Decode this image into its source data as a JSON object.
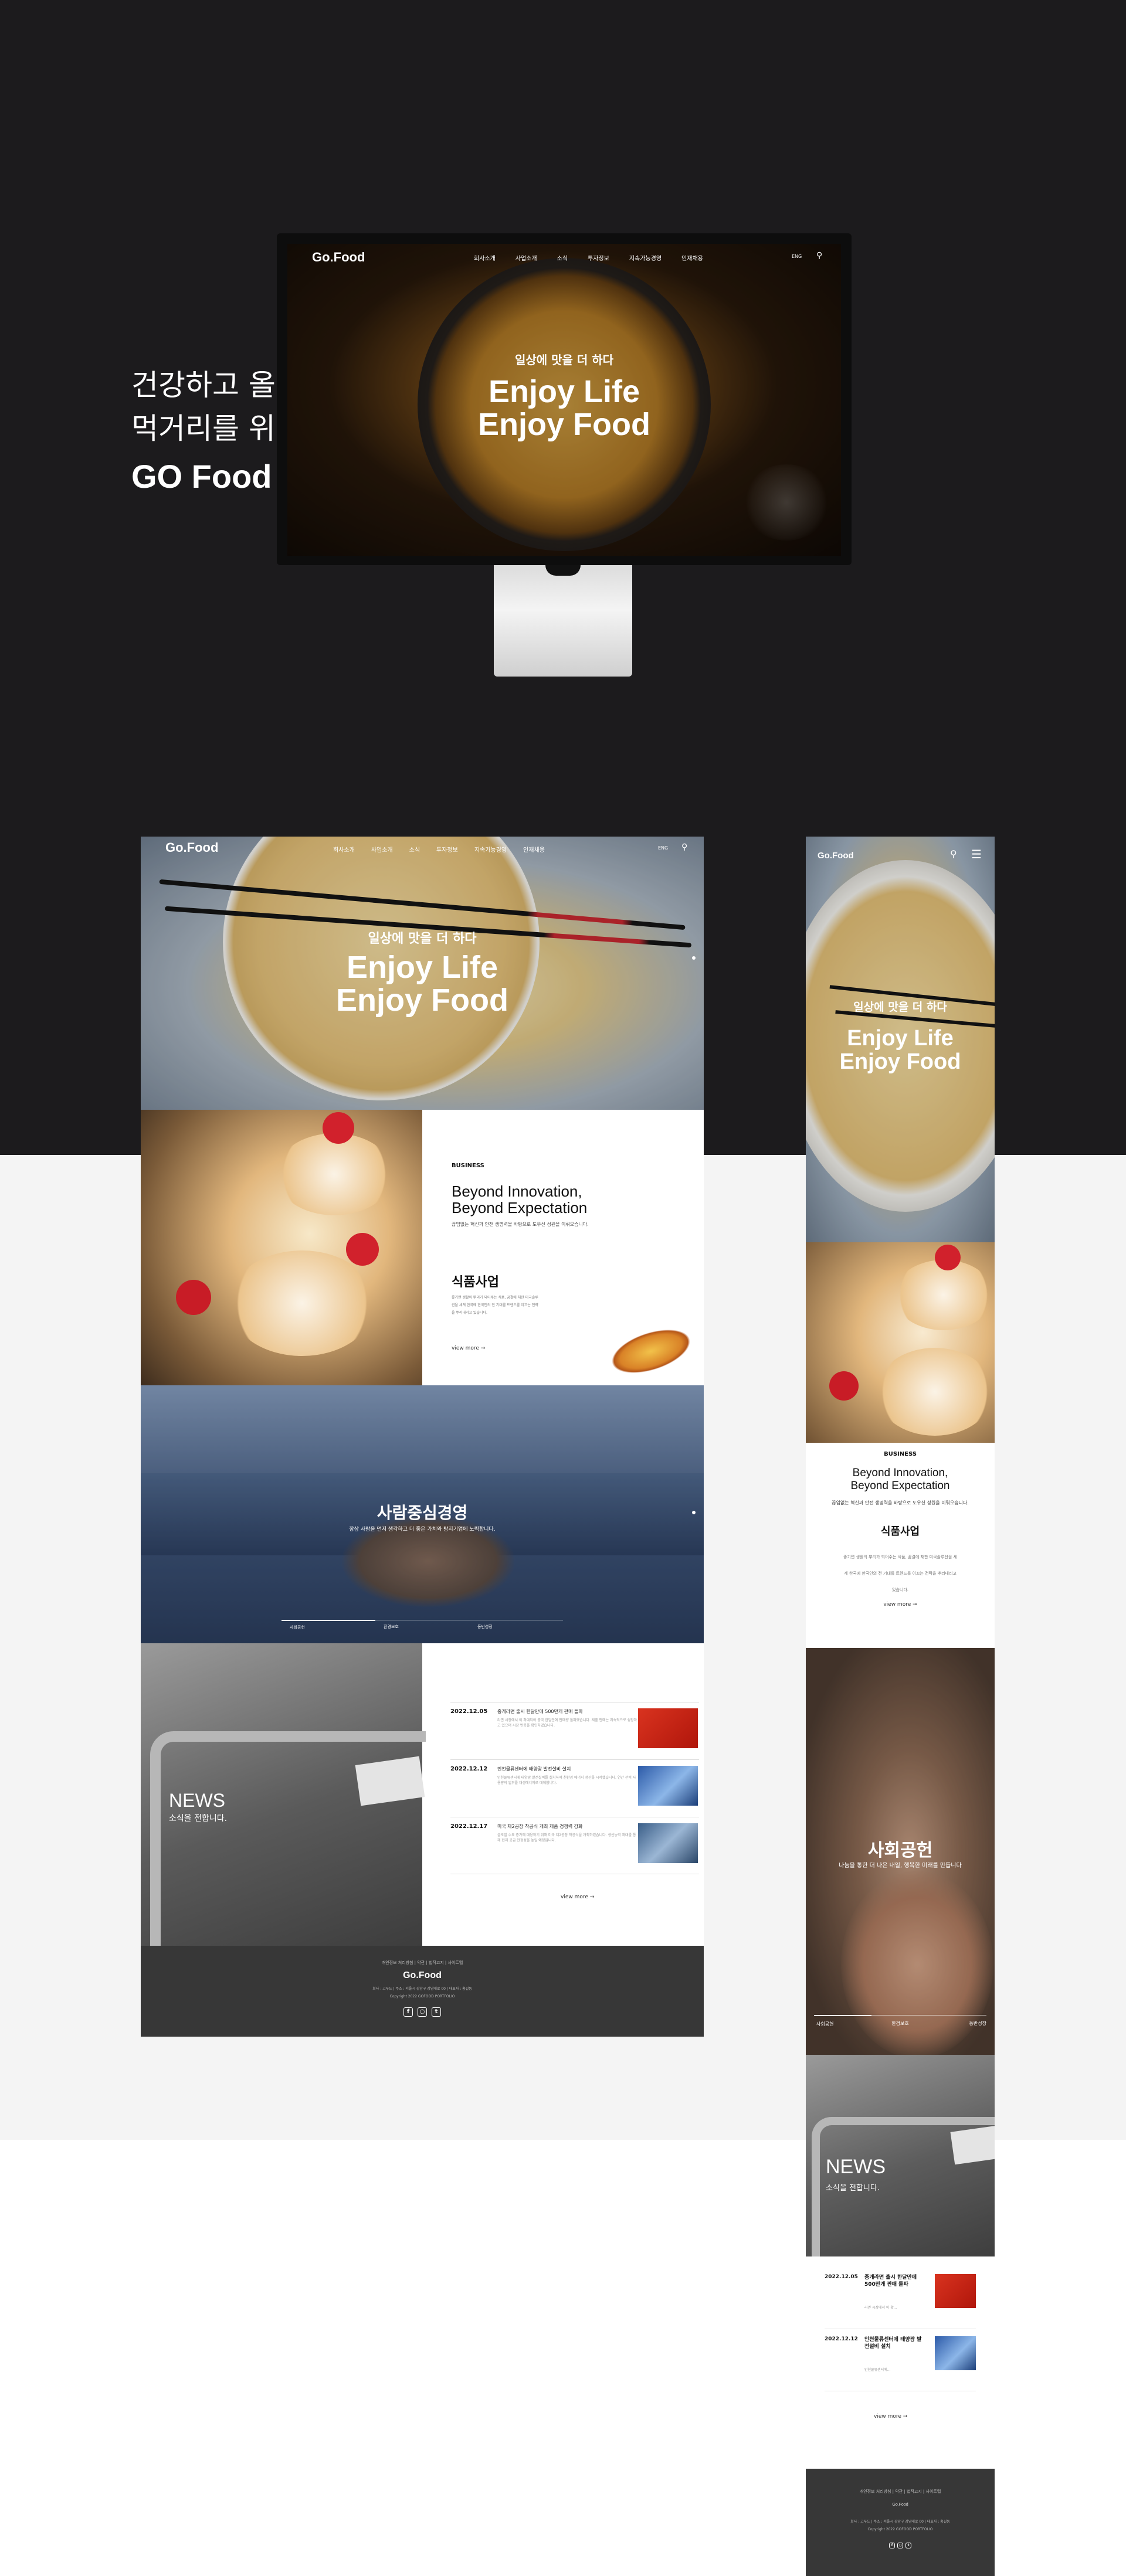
{
  "intro": {
    "line1": "건강하고 올바른",
    "line2": "먹거리를 위해",
    "line3": "GO Food"
  },
  "brand": {
    "logo": "Go.Food"
  },
  "nav": {
    "items": [
      "회사소개",
      "사업소개",
      "소식",
      "투자정보",
      "지속가능경영",
      "인재채용"
    ],
    "lang": "ENG",
    "search_icon": "search-icon",
    "menu_icon": "hamburger-icon"
  },
  "hero": {
    "subtitle": "일상에 맛을 더 하다",
    "title_line1": "Enjoy Life",
    "title_line2": "Enjoy Food"
  },
  "business": {
    "label": "BUSINESS",
    "heading_line1": "Beyond Innovation,",
    "heading_line2": "Beyond Expectation",
    "description": "끊임없는 혁신과 안전 생명력을 바탕으로 도우신 성원을 이뤄오습니다.",
    "section_title": "식품사업",
    "section_text": "좋기면 생활의 뿌리가 되어주는 식품, 꿈결에 채판 미국솔루션을 세계 한국에 한국인의 전 기대를 트렌드를 이끄는 전략을 뿌리내리고 있습니다.",
    "view_more": "view more"
  },
  "people": {
    "title": "사람중심경영",
    "subtitle": "항상 사람을 먼저 생각하고 더 좋은 가치와 탕지기업에 노력합니다.",
    "tabs": [
      "사회공헌",
      "환경보호",
      "동반성장"
    ]
  },
  "social": {
    "title": "사회공헌",
    "subtitle": "나눔을 통한 더 나은 내일, 행복한 미래를 만듭니다"
  },
  "news": {
    "title": "NEWS",
    "subtitle": "소식을 전합니다.",
    "view_more": "view more",
    "items": [
      {
        "date": "2022.12.05",
        "title": "중개라면 출시 한달만에 500만개 판매 돌파",
        "body": "라면 시장에서 이 확대되어 중국 한달만에 판매량 돌파했습니다. 제품 판매는 지속적으로 성장하고 있으며 시장 반응을 확인하였습니다."
      },
      {
        "date": "2022.12.12",
        "title": "인천물류센터에 태양광 발전설비 설치",
        "body": "인천물류센터에 태양광 발전설비를 설치하여 친환경 에너지 생산을 시작했습니다. 연간 전력 사용량의 일부를 재생에너지로 대체합니다."
      },
      {
        "date": "2022.12.17",
        "title": "미국 제2공장 착공식 개최 제품 경쟁력 강화",
        "body": "글로벌 수요 증가에 대응하기 위해 미국 제2공장 착공식을 개최하였습니다. 생산능력 확대를 통해 현지 공급 안정성을 높일 예정입니다."
      }
    ],
    "mobile_items": [
      {
        "date": "2022.12.05",
        "title": "중개라면 출시 한달만에 500만개 판매 돌파",
        "body": "라면 시장에서 이 확..."
      },
      {
        "date": "2022.12.12",
        "title": "인천물류센터에 태양광 발전설비 설치",
        "body": "인천물류센터에..."
      }
    ]
  },
  "footer": {
    "links": "개인정보 처리방침 | 약관 | 법적고지 | 사이트맵",
    "logo": "Go.Food",
    "address": "회사 : 고푸드 | 주소 : 서울시 강남구 강남대로 00 | 대표자 : 홍길동",
    "copyright": "Copyright 2022 GOFOOD PORTFOLIO",
    "social_icons": [
      "facebook-icon",
      "instagram-icon",
      "twitter-icon"
    ]
  },
  "colors": {
    "dark_bg": "#1c1b1d",
    "light_bg": "#f4f4f4",
    "footer_bg": "#373737",
    "accent_red": "#c8262e"
  }
}
